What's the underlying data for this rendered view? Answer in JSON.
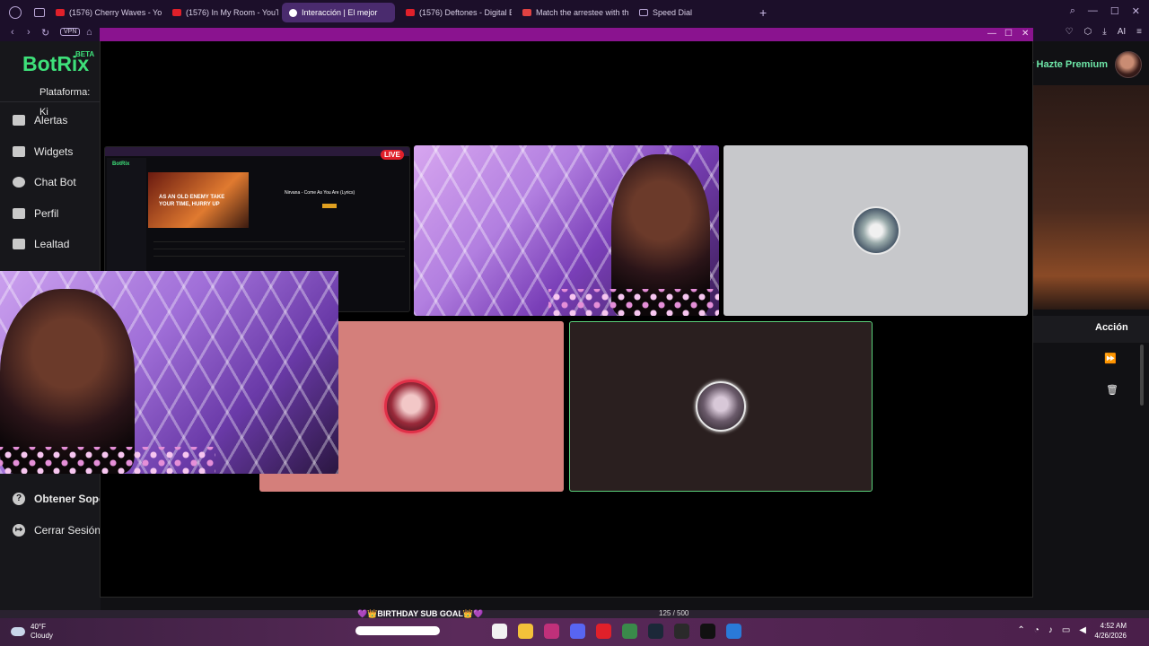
{
  "browser": {
    "tabs": [
      {
        "title": "(1576) Cherry Waves - Yo",
        "icon": "youtube-icon",
        "active": false
      },
      {
        "title": "(1576) In My Room - YouT",
        "icon": "youtube-icon",
        "active": false
      },
      {
        "title": "Interacción | El mejor",
        "icon": "botrix-icon",
        "active": true
      },
      {
        "title": "(1576) Deftones - Digital B",
        "icon": "youtube-icon",
        "active": false
      },
      {
        "title": "Match the arrestee with th",
        "icon": "match-icon",
        "active": false
      },
      {
        "title": "Speed Dial",
        "icon": "speed-dial-icon",
        "active": false
      }
    ],
    "vpn_label": "VPN",
    "ai_label": "AI",
    "new_tab": "+"
  },
  "site": {
    "logo": "BotRix",
    "beta": "BETA",
    "platform_label": "Plataforma: Ki",
    "premium": "r Hazte Premium",
    "sidebar": [
      {
        "label": "Alertas",
        "icon": "bell-icon"
      },
      {
        "label": "Widgets",
        "icon": "grid-icon"
      },
      {
        "label": "Chat Bot",
        "icon": "robot-icon"
      },
      {
        "label": "Perfil",
        "icon": "id-card-icon"
      },
      {
        "label": "Lealtad",
        "icon": "trophy-icon"
      }
    ],
    "support": "Obtener Sopor",
    "logout": "Cerrar Sesión",
    "action_header": "Acción",
    "icon_glyphs": {
      "support": "?",
      "logout": "↦"
    }
  },
  "call": {
    "live_badge": "LIVE",
    "mini_screen": {
      "logo": "BotRix",
      "thumb_text": "AS AN OLD ENEMY TAKE YOUR TIME, HURRY UP",
      "title": "Nirvana - Come As You Are (Lyrics)"
    }
  },
  "stream": {
    "goal": "💜👑BIRTHDAY SUB GOAL👑💜",
    "goal_count": "125 / 500"
  },
  "taskbar": {
    "weather_temp": "40°F",
    "weather_desc": "Cloudy",
    "time": "4:52 AM",
    "date": "4/26/2026"
  }
}
